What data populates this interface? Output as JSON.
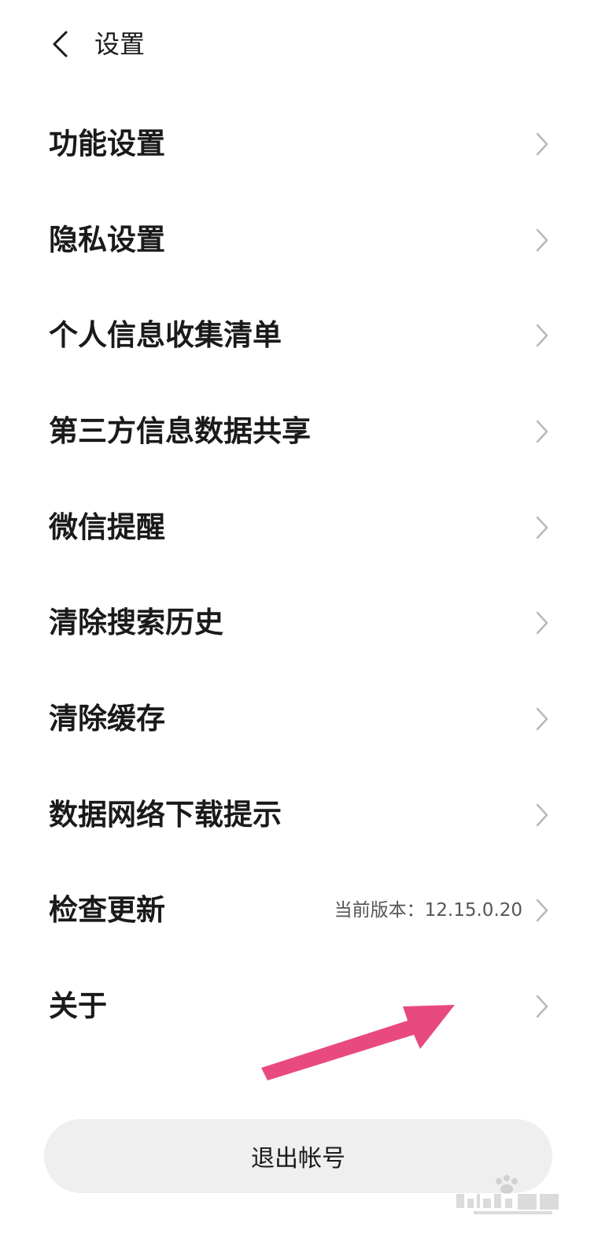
{
  "header": {
    "back_icon": "chevron-left-icon",
    "title": "设置"
  },
  "menu": {
    "items": [
      {
        "label": "功能设置",
        "icon": "chevron-right-icon"
      },
      {
        "label": "隐私设置",
        "icon": "chevron-right-icon"
      },
      {
        "label": "个人信息收集清单",
        "icon": "chevron-right-icon"
      },
      {
        "label": "第三方信息数据共享",
        "icon": "chevron-right-icon"
      },
      {
        "label": "微信提醒",
        "icon": "chevron-right-icon"
      },
      {
        "label": "清除搜索历史",
        "icon": "chevron-right-icon"
      },
      {
        "label": "清除缓存",
        "icon": "chevron-right-icon"
      },
      {
        "label": "数据网络下载提示",
        "icon": "chevron-right-icon"
      },
      {
        "label": "检查更新",
        "value": "当前版本：12.15.0.20",
        "icon": "chevron-right-icon"
      },
      {
        "label": "关于",
        "icon": "chevron-right-icon"
      }
    ]
  },
  "logout": {
    "label": "退出帐号"
  },
  "annotation": {
    "arrow_color": "#e84a7f"
  },
  "watermark": {
    "text": "Baidu经验",
    "subtext": "jingyan.baidu.com"
  },
  "colors": {
    "background": "#ffffff",
    "text": "#1a1a1a",
    "chevron": "#b8b8b8",
    "button_bg": "#efefef",
    "annotation_arrow": "#e84a7f"
  }
}
